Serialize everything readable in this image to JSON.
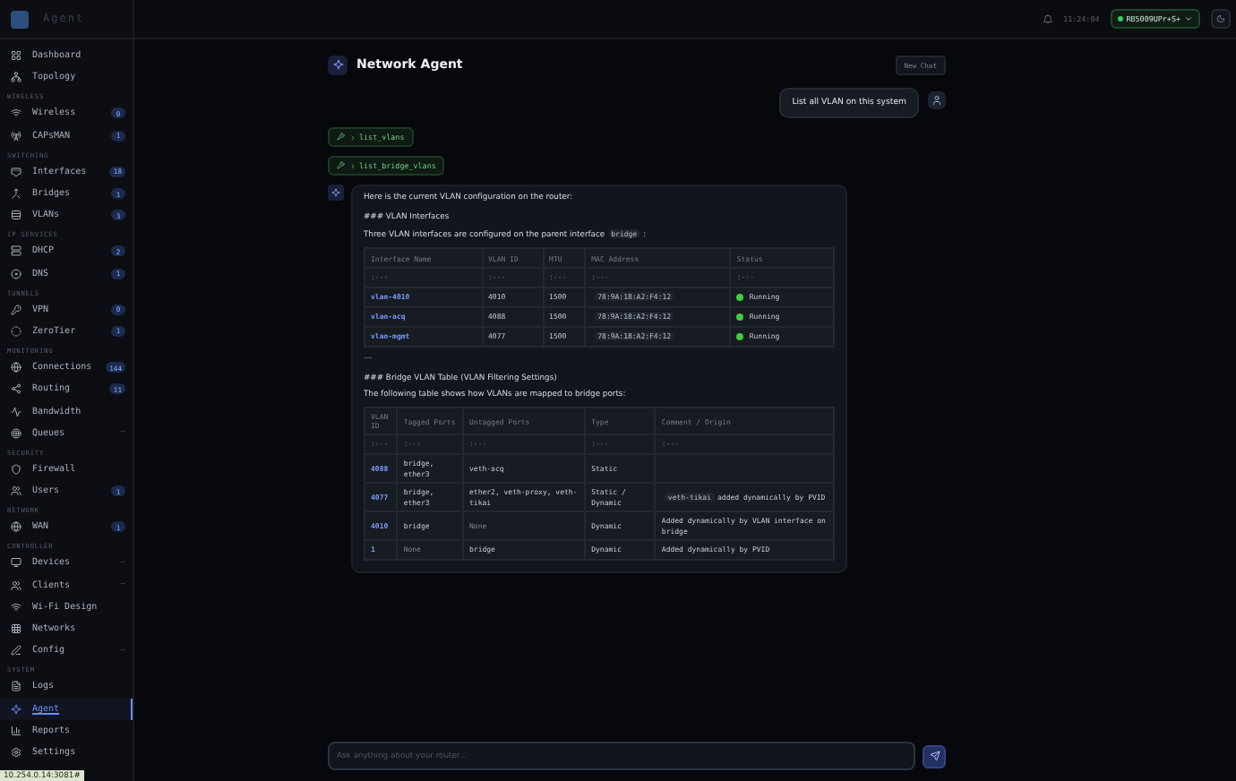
{
  "sidebar": {
    "brand": "Agent",
    "sections": [
      {
        "items": [
          {
            "label": "Dashboard",
            "selected": false
          },
          {
            "label": "Topology",
            "selected": false
          }
        ]
      },
      {
        "label": "WIRELESS",
        "items": [
          {
            "label": "Wireless",
            "badge": "0",
            "selected": false
          },
          {
            "label": "CAPsMAN",
            "badge": "1",
            "selected": false
          }
        ]
      },
      {
        "label": "SWITCHING",
        "items": [
          {
            "label": "Interfaces",
            "badge": "18",
            "selected": false
          },
          {
            "label": "Bridges",
            "badge": "1",
            "selected": false
          },
          {
            "label": "VLANs",
            "badge": "3",
            "selected": false
          }
        ]
      },
      {
        "label": "IP SERVICES",
        "items": [
          {
            "label": "DHCP",
            "badge": "2",
            "selected": false
          },
          {
            "label": "DNS",
            "badge": "1",
            "selected": false
          }
        ]
      },
      {
        "label": "TUNNELS",
        "items": [
          {
            "label": "VPN",
            "badge": "0",
            "selected": false
          },
          {
            "label": "ZeroTier",
            "badge": "1",
            "selected": false
          }
        ]
      },
      {
        "label": "MONITORING",
        "items": [
          {
            "label": "Connections",
            "badge": "144",
            "selected": false
          },
          {
            "label": "Routing",
            "badge": "11",
            "selected": false
          },
          {
            "label": "Bandwidth",
            "selected": false
          },
          {
            "label": "Queues",
            "note": "—",
            "selected": false
          }
        ]
      },
      {
        "label": "SECURITY",
        "items": [
          {
            "label": "Firewall",
            "selected": false
          },
          {
            "label": "Users",
            "badge": "1",
            "selected": false
          }
        ]
      },
      {
        "label": "NETWORK",
        "items": [
          {
            "label": "WAN",
            "badge": "1",
            "selected": false
          }
        ]
      },
      {
        "label": "CONTROLLER",
        "items": [
          {
            "label": "Devices",
            "note": "—",
            "selected": false
          },
          {
            "label": "Clients",
            "note": "—",
            "selected": false
          },
          {
            "label": "Wi-Fi Design",
            "selected": false
          },
          {
            "label": "Networks",
            "selected": false
          },
          {
            "label": "Config",
            "note": "—",
            "selected": false
          }
        ]
      },
      {
        "label": "SYSTEM",
        "items": [
          {
            "label": "Logs",
            "selected": false
          },
          {
            "label": "Agent",
            "selected": true
          },
          {
            "label": "Reports",
            "selected": false
          },
          {
            "label": "Settings",
            "selected": false
          }
        ]
      }
    ]
  },
  "header": {
    "time": "11:24:04",
    "device": "RB5009UPr+S+"
  },
  "chat": {
    "title": "Network Agent",
    "new_chat": "New Chat",
    "messages": [
      {
        "kind": "user",
        "text": "List all VLAN on this system"
      },
      {
        "kind": "tool",
        "text": "list_vlans"
      },
      {
        "kind": "tool",
        "text": "list_bridge_vlans"
      },
      {
        "kind": "assistant",
        "blocks": [
          {
            "kind": "text",
            "parts": [
              {
                "kind": "text",
                "text": "Here is the current VLAN configuration on the router:"
              }
            ]
          },
          {
            "kind": "heading",
            "text": "### VLAN Interfaces"
          },
          {
            "kind": "text",
            "parts": [
              {
                "kind": "text",
                "text": "Three VLAN interfaces are configured on the parent interface"
              },
              {
                "kind": "code",
                "text": "bridge"
              },
              {
                "kind": "text",
                "text": ":"
              }
            ]
          },
          {
            "kind": "table",
            "columns": [
              {
                "label": "Interface Name",
                "kind": "id"
              },
              {
                "label": "VLAN ID",
                "kind": "text"
              },
              {
                "label": "MTU",
                "kind": "text"
              },
              {
                "label": "MAC Address",
                "kind": "code"
              },
              {
                "label": "Status",
                "kind": "status"
              }
            ],
            "rows": [
              {
                "kind": "separator",
                "cells": [
                  ":---",
                  ":---",
                  ":---",
                  ":---",
                  ":---"
                ]
              },
              {
                "kind": "data",
                "cells": [
                  "vlan-4010",
                  "4010",
                  "1500",
                  "78:9A:18:A2:F4:12",
                  "Running"
                ]
              },
              {
                "kind": "data",
                "cells": [
                  "vlan-acq",
                  "4088",
                  "1500",
                  "78:9A:18:A2:F4:12",
                  "Running"
                ]
              },
              {
                "kind": "data",
                "cells": [
                  "vlan-mgmt",
                  "4077",
                  "1500",
                  "78:9A:18:A2:F4:12",
                  "Running"
                ]
              }
            ]
          },
          {
            "kind": "rule",
            "text": "---"
          },
          {
            "kind": "heading",
            "text": "### Bridge VLAN Table (VLAN Filtering Settings)"
          },
          {
            "kind": "text",
            "parts": [
              {
                "kind": "text",
                "text": "The following table shows how VLANs are mapped to bridge ports:"
              }
            ]
          },
          {
            "kind": "table",
            "columns": [
              {
                "label": "VLAN ID",
                "kind": "id"
              },
              {
                "label": "Tagged Ports",
                "kind": "text"
              },
              {
                "label": "Untagged Ports",
                "kind": "text"
              },
              {
                "label": "Type",
                "kind": "text"
              },
              {
                "label": "Comment / Origin",
                "kind": "text"
              }
            ],
            "rows": [
              {
                "kind": "separator",
                "cells": [
                  ":---",
                  ":---",
                  ":---",
                  ":---",
                  ":---"
                ]
              },
              {
                "kind": "data",
                "cells": [
                  "4088",
                  "bridge, ether3",
                  "veth-acq",
                  "Static",
                  ""
                ]
              },
              {
                "kind": "data",
                "cells": [
                  "4077",
                  "bridge, ether3",
                  "ether2, veth-proxy, veth-tikai",
                  "Static / Dynamic",
                  {
                    "parts": [
                      {
                        "kind": "code",
                        "text": "veth-tikai"
                      },
                      {
                        "kind": "text",
                        "text": "added dynamically by PVID"
                      }
                    ]
                  }
                ]
              },
              {
                "kind": "data",
                "cells": [
                  "4010",
                  "bridge",
                  {
                    "kind": "none",
                    "text": "None"
                  },
                  "Dynamic",
                  "Added dynamically by VLAN interface on bridge"
                ]
              },
              {
                "kind": "data",
                "cells": [
                  "1",
                  {
                    "kind": "none",
                    "text": "None"
                  },
                  "bridge",
                  "Dynamic",
                  "Added dynamically by PVID"
                ]
              }
            ]
          }
        ]
      }
    ],
    "input": {
      "placeholder": "Ask anything about your router..."
    }
  },
  "status_url": "10.254.0.14:3081#"
}
